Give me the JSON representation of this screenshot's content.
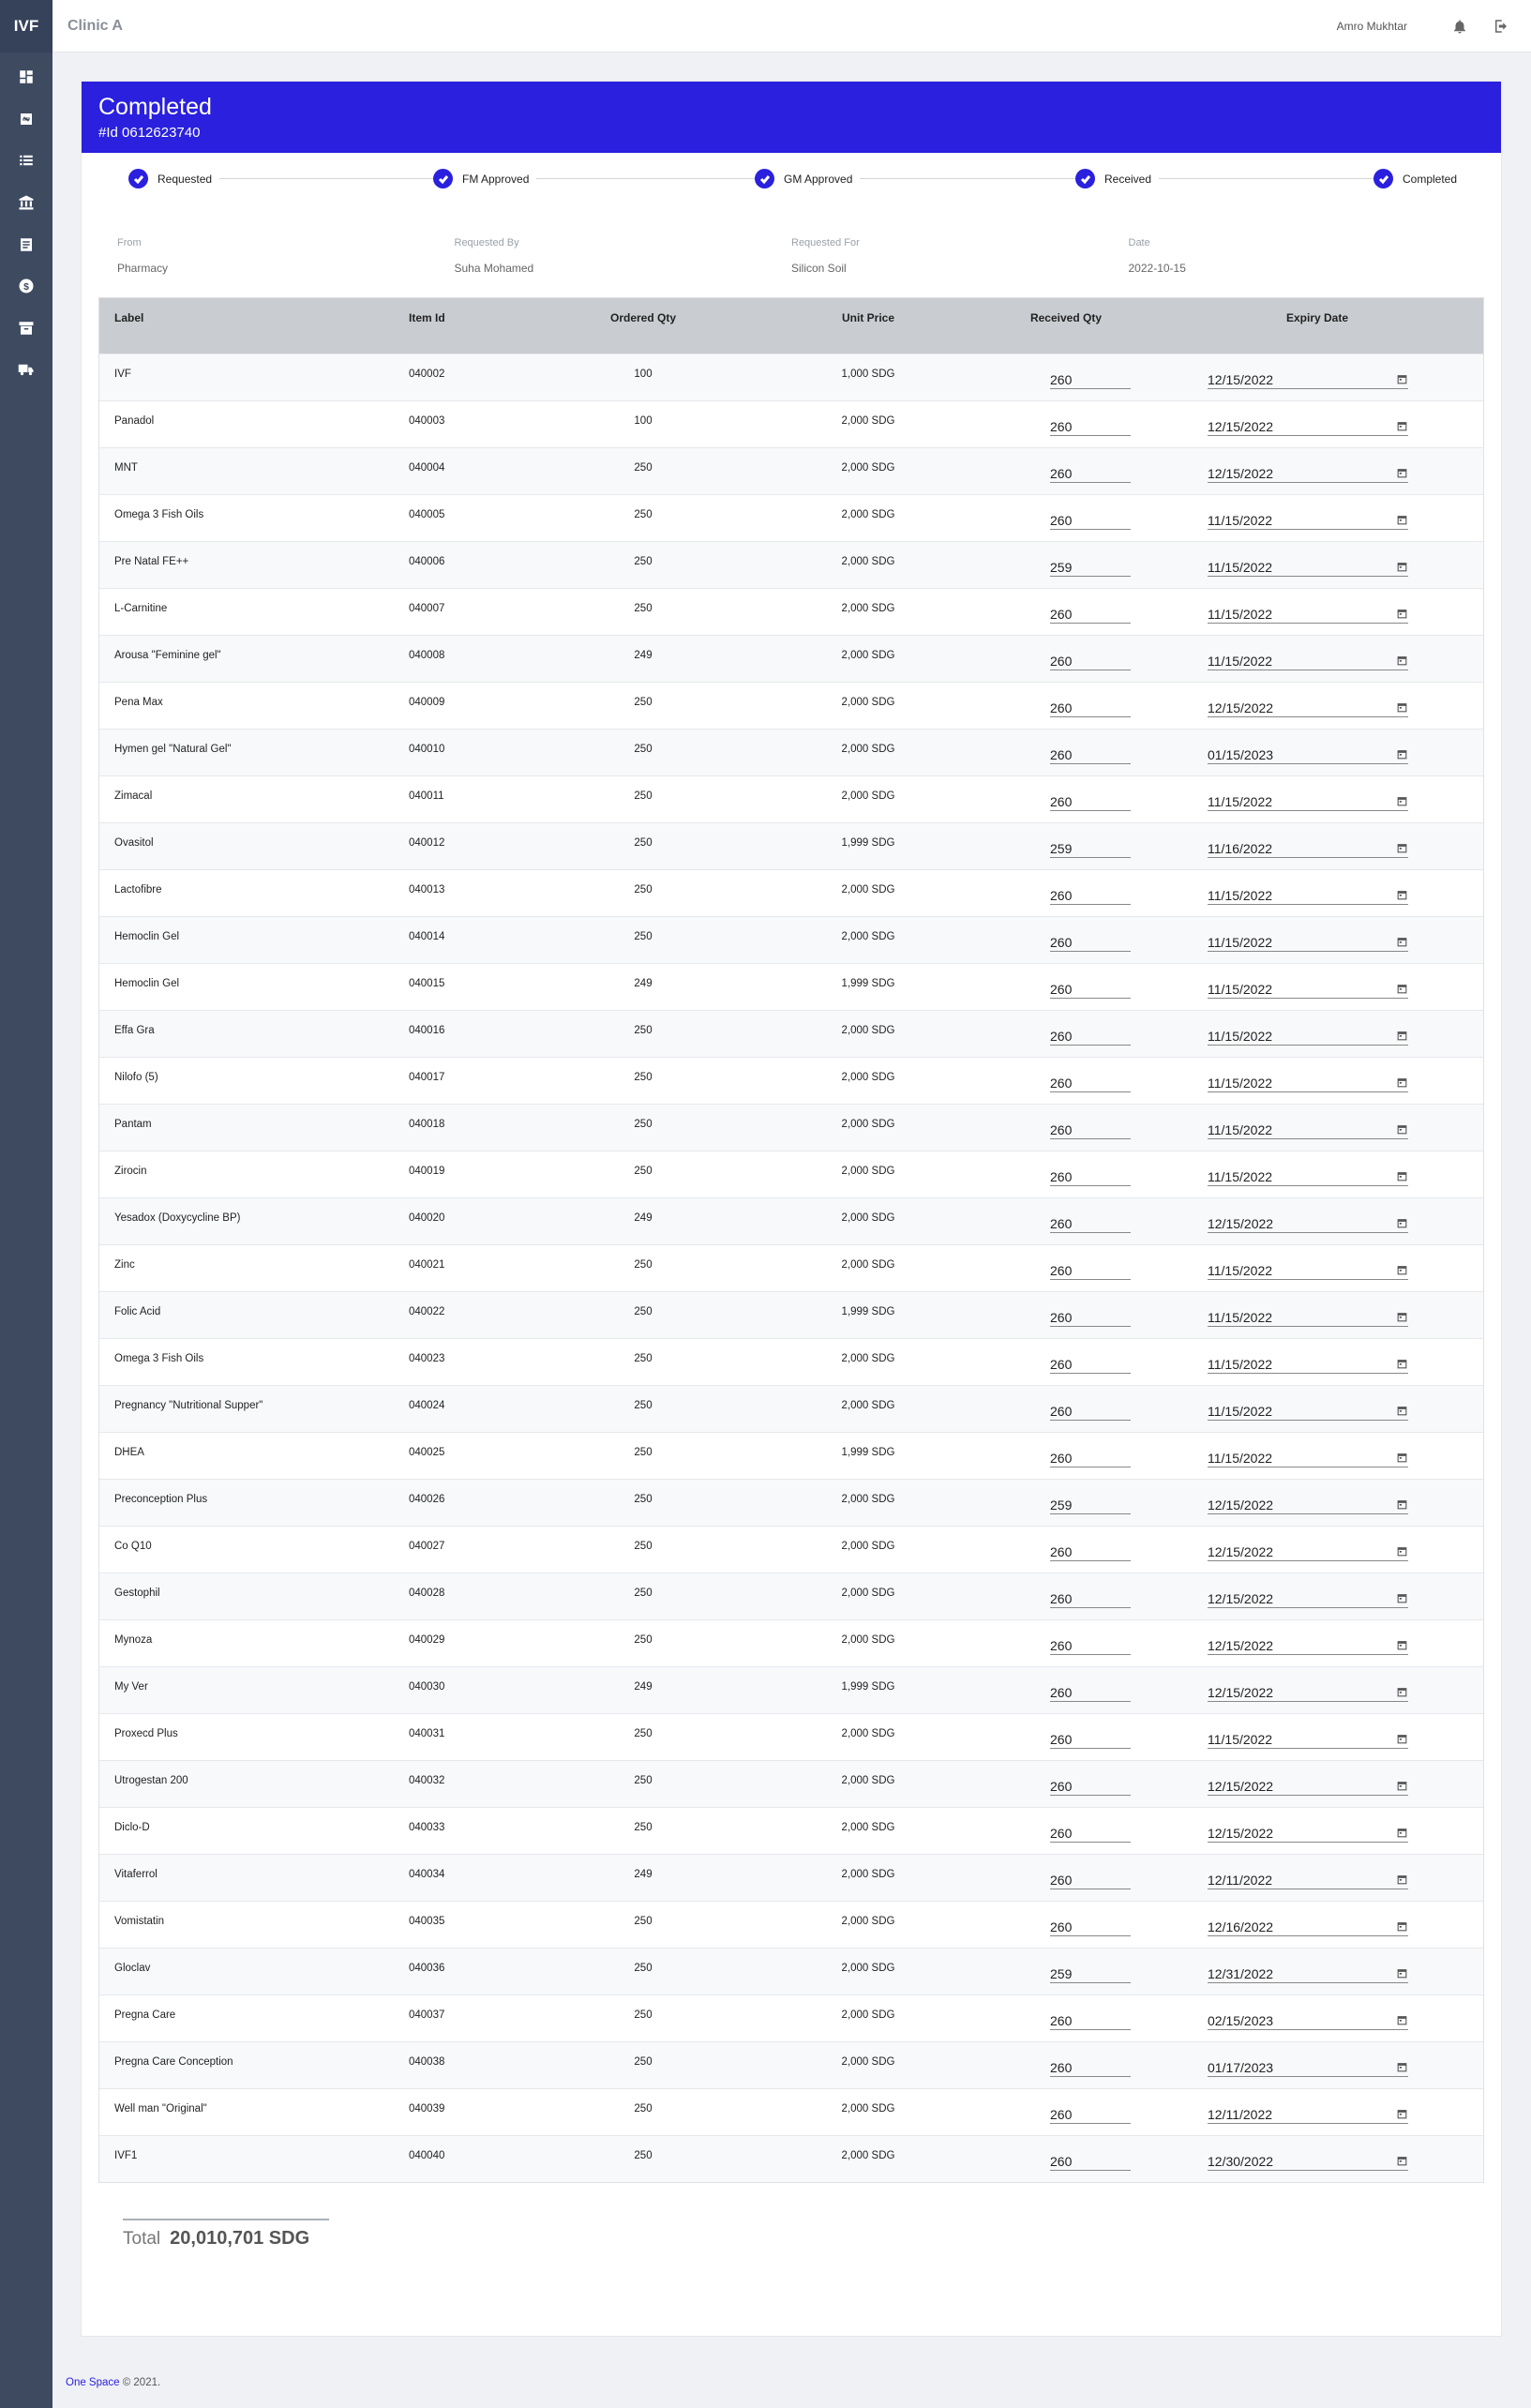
{
  "sidebar": {
    "brand": "IVF",
    "items": [
      "dashboard-icon",
      "transfer-icon",
      "list-icon",
      "bank-icon",
      "document-icon",
      "dollar-icon",
      "archive-icon",
      "truck-icon"
    ]
  },
  "topbar": {
    "clinic": "Clinic A",
    "user": "Amro Mukhtar",
    "notification_icon": "bell-icon",
    "logout_icon": "logout-icon"
  },
  "header": {
    "title": "Completed",
    "id_label": "#Id 0612623740",
    "color": "#2a20de"
  },
  "steps": [
    "Requested",
    "FM Approved",
    "GM Approved",
    "Received",
    "Completed"
  ],
  "info": {
    "from_label": "From",
    "from_value": "Pharmacy",
    "by_label": "Requested By",
    "by_value": "Suha Mohamed",
    "for_label": "Requested For",
    "for_value": "Silicon Soil",
    "date_label": "Date",
    "date_value": "2022-10-15"
  },
  "table": {
    "headers": [
      "Label",
      "Item Id",
      "Ordered Qty",
      "Unit Price",
      "Received Qty",
      "Expiry Date"
    ],
    "rows": [
      [
        "IVF",
        "040002",
        "100",
        "1,000 SDG",
        "260",
        "12/15/2022"
      ],
      [
        "Panadol",
        "040003",
        "100",
        "2,000 SDG",
        "260",
        "12/15/2022"
      ],
      [
        "MNT",
        "040004",
        "250",
        "2,000 SDG",
        "260",
        "12/15/2022"
      ],
      [
        "Omega 3 Fish Oils",
        "040005",
        "250",
        "2,000 SDG",
        "260",
        "11/15/2022"
      ],
      [
        "Pre Natal FE++",
        "040006",
        "250",
        "2,000 SDG",
        "259",
        "11/15/2022"
      ],
      [
        "L-Carnitine",
        "040007",
        "250",
        "2,000 SDG",
        "260",
        "11/15/2022"
      ],
      [
        "Arousa \"Feminine gel\"",
        "040008",
        "249",
        "2,000 SDG",
        "260",
        "11/15/2022"
      ],
      [
        "Pena Max",
        "040009",
        "250",
        "2,000 SDG",
        "260",
        "12/15/2022"
      ],
      [
        "Hymen gel \"Natural Gel\"",
        "040010",
        "250",
        "2,000 SDG",
        "260",
        "01/15/2023"
      ],
      [
        "Zimacal",
        "040011",
        "250",
        "2,000 SDG",
        "260",
        "11/15/2022"
      ],
      [
        "Ovasitol",
        "040012",
        "250",
        "1,999 SDG",
        "259",
        "11/16/2022"
      ],
      [
        "Lactofibre",
        "040013",
        "250",
        "2,000 SDG",
        "260",
        "11/15/2022"
      ],
      [
        "Hemoclin Gel",
        "040014",
        "250",
        "2,000 SDG",
        "260",
        "11/15/2022"
      ],
      [
        "Hemoclin Gel",
        "040015",
        "249",
        "1,999 SDG",
        "260",
        "11/15/2022"
      ],
      [
        "Effa Gra",
        "040016",
        "250",
        "2,000 SDG",
        "260",
        "11/15/2022"
      ],
      [
        "Nilofo (5)",
        "040017",
        "250",
        "2,000 SDG",
        "260",
        "11/15/2022"
      ],
      [
        "Pantam",
        "040018",
        "250",
        "2,000 SDG",
        "260",
        "11/15/2022"
      ],
      [
        "Zirocin",
        "040019",
        "250",
        "2,000 SDG",
        "260",
        "11/15/2022"
      ],
      [
        "Yesadox (Doxycycline BP)",
        "040020",
        "249",
        "2,000 SDG",
        "260",
        "12/15/2022"
      ],
      [
        "Zinc",
        "040021",
        "250",
        "2,000 SDG",
        "260",
        "11/15/2022"
      ],
      [
        "Folic Acid",
        "040022",
        "250",
        "1,999 SDG",
        "260",
        "11/15/2022"
      ],
      [
        "Omega 3 Fish Oils",
        "040023",
        "250",
        "2,000 SDG",
        "260",
        "11/15/2022"
      ],
      [
        "Pregnancy \"Nutritional Supper\"",
        "040024",
        "250",
        "2,000 SDG",
        "260",
        "11/15/2022"
      ],
      [
        "DHEA",
        "040025",
        "250",
        "1,999 SDG",
        "260",
        "11/15/2022"
      ],
      [
        "Preconception Plus",
        "040026",
        "250",
        "2,000 SDG",
        "259",
        "12/15/2022"
      ],
      [
        "Co Q10",
        "040027",
        "250",
        "2,000 SDG",
        "260",
        "12/15/2022"
      ],
      [
        "Gestophil",
        "040028",
        "250",
        "2,000 SDG",
        "260",
        "12/15/2022"
      ],
      [
        "Mynoza",
        "040029",
        "250",
        "2,000 SDG",
        "260",
        "12/15/2022"
      ],
      [
        "My Ver",
        "040030",
        "249",
        "1,999 SDG",
        "260",
        "12/15/2022"
      ],
      [
        "Proxecd Plus",
        "040031",
        "250",
        "2,000 SDG",
        "260",
        "11/15/2022"
      ],
      [
        "Utrogestan 200",
        "040032",
        "250",
        "2,000 SDG",
        "260",
        "12/15/2022"
      ],
      [
        "Diclo-D",
        "040033",
        "250",
        "2,000 SDG",
        "260",
        "12/15/2022"
      ],
      [
        "Vitaferrol",
        "040034",
        "249",
        "2,000 SDG",
        "260",
        "12/11/2022"
      ],
      [
        "Vomistatin",
        "040035",
        "250",
        "2,000 SDG",
        "260",
        "12/16/2022"
      ],
      [
        "Gloclav",
        "040036",
        "250",
        "2,000 SDG",
        "259",
        "12/31/2022"
      ],
      [
        "Pregna Care",
        "040037",
        "250",
        "2,000 SDG",
        "260",
        "02/15/2023"
      ],
      [
        "Pregna Care Conception",
        "040038",
        "250",
        "2,000 SDG",
        "260",
        "01/17/2023"
      ],
      [
        "Well man \"Original\"",
        "040039",
        "250",
        "2,000 SDG",
        "260",
        "12/11/2022"
      ],
      [
        "IVF1",
        "040040",
        "250",
        "2,000 SDG",
        "260",
        "12/30/2022"
      ]
    ]
  },
  "total": {
    "label": "Total",
    "value": "20,010,701 SDG"
  },
  "footer": {
    "link": "One Space",
    "text": " © 2021."
  }
}
